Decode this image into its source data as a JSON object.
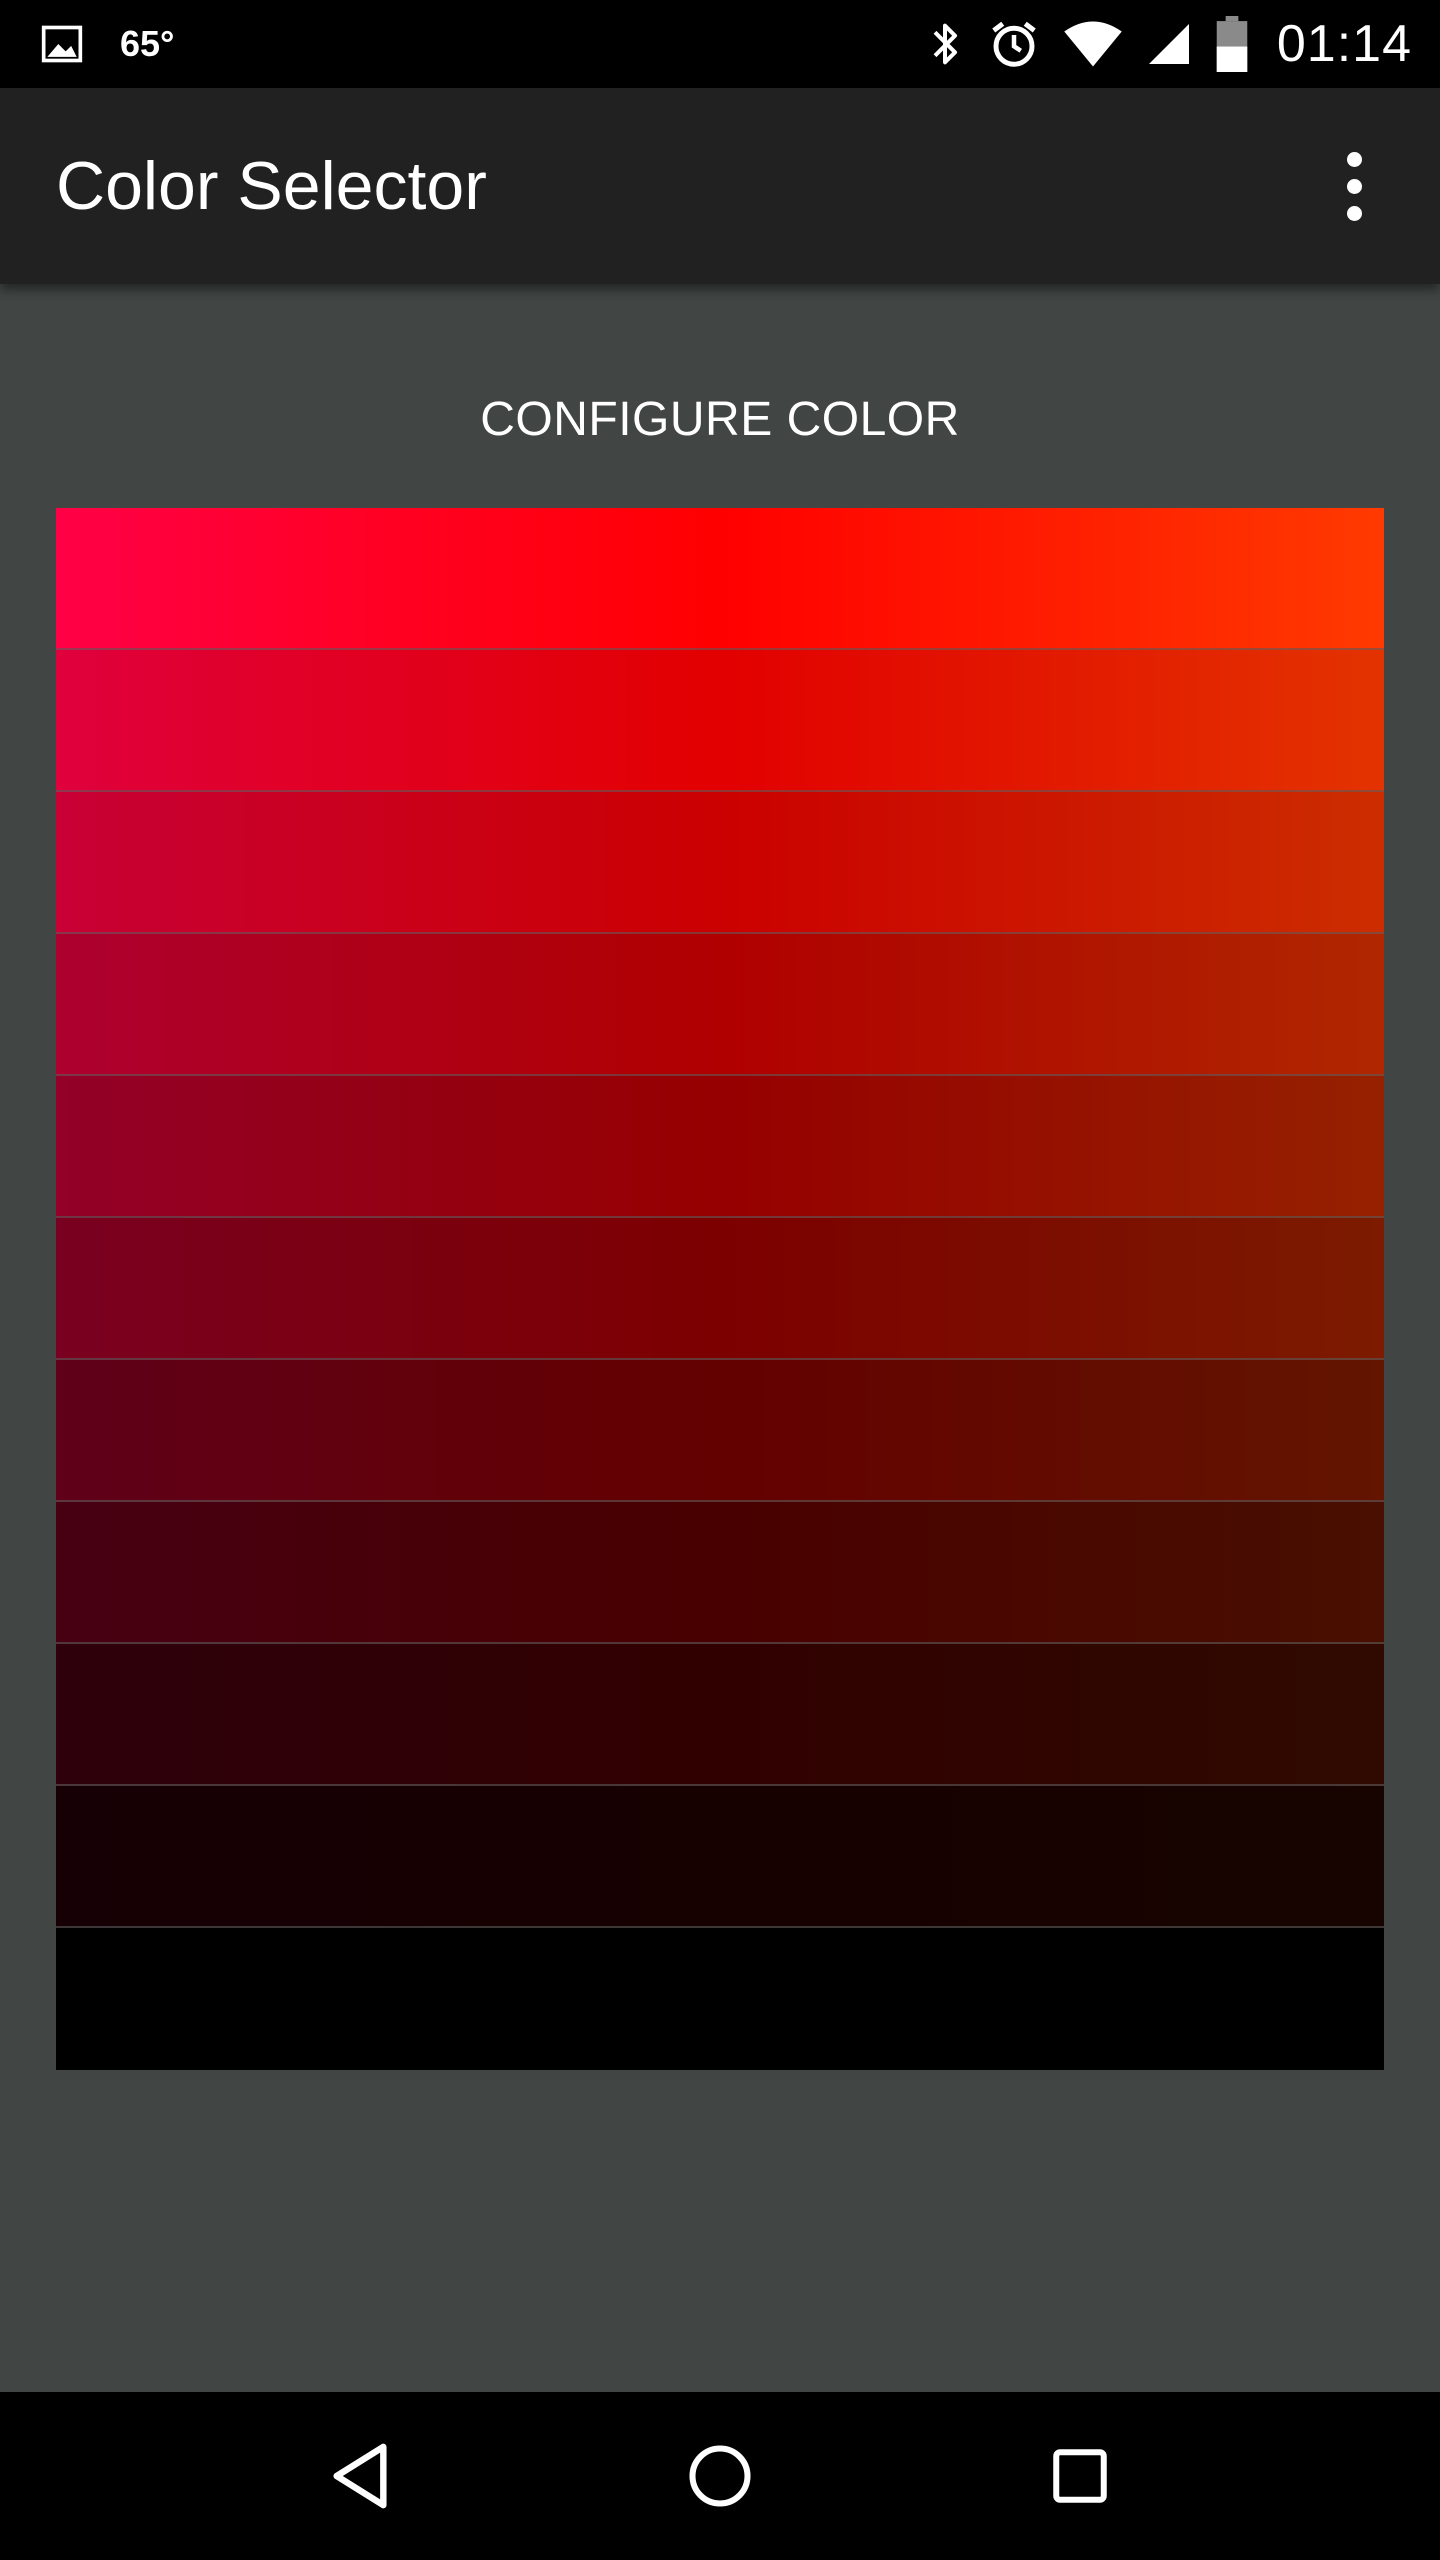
{
  "status_bar": {
    "temperature": "65°",
    "time": "01:14",
    "icons": [
      "image-notification-icon",
      "bluetooth-icon",
      "alarm-icon",
      "wifi-icon",
      "cell-signal-icon",
      "battery-icon"
    ]
  },
  "app_bar": {
    "title": "Color Selector",
    "overflow_icon": "more-vert-icon"
  },
  "main": {
    "heading": "CONFIGURE COLOR",
    "swatches": [
      {
        "from": "#ff0046",
        "mid": "#ff0000",
        "to": "#ff3a00"
      },
      {
        "from": "#e0003d",
        "mid": "#e20000",
        "to": "#e33300"
      },
      {
        "from": "#c80036",
        "mid": "#cb0000",
        "to": "#cc2d00"
      },
      {
        "from": "#ae002f",
        "mid": "#b00000",
        "to": "#b02700"
      },
      {
        "from": "#930028",
        "mid": "#960000",
        "to": "#962100"
      },
      {
        "from": "#7a0021",
        "mid": "#7c0000",
        "to": "#7c1b00"
      },
      {
        "from": "#600019",
        "mid": "#630000",
        "to": "#631500"
      },
      {
        "from": "#460012",
        "mid": "#490000",
        "to": "#490f00"
      },
      {
        "from": "#2e000b",
        "mid": "#300000",
        "to": "#300a00"
      },
      {
        "from": "#160005",
        "mid": "#170000",
        "to": "#170400"
      },
      {
        "from": "#000000",
        "mid": "#000000",
        "to": "#000000"
      }
    ]
  },
  "nav_bar": {
    "icons": [
      "back-icon",
      "home-icon",
      "recents-icon"
    ]
  },
  "colors": {
    "status_bar_bg": "#000000",
    "app_bar_bg": "#212121",
    "content_bg": "#414644",
    "nav_bar_bg": "#000000"
  }
}
